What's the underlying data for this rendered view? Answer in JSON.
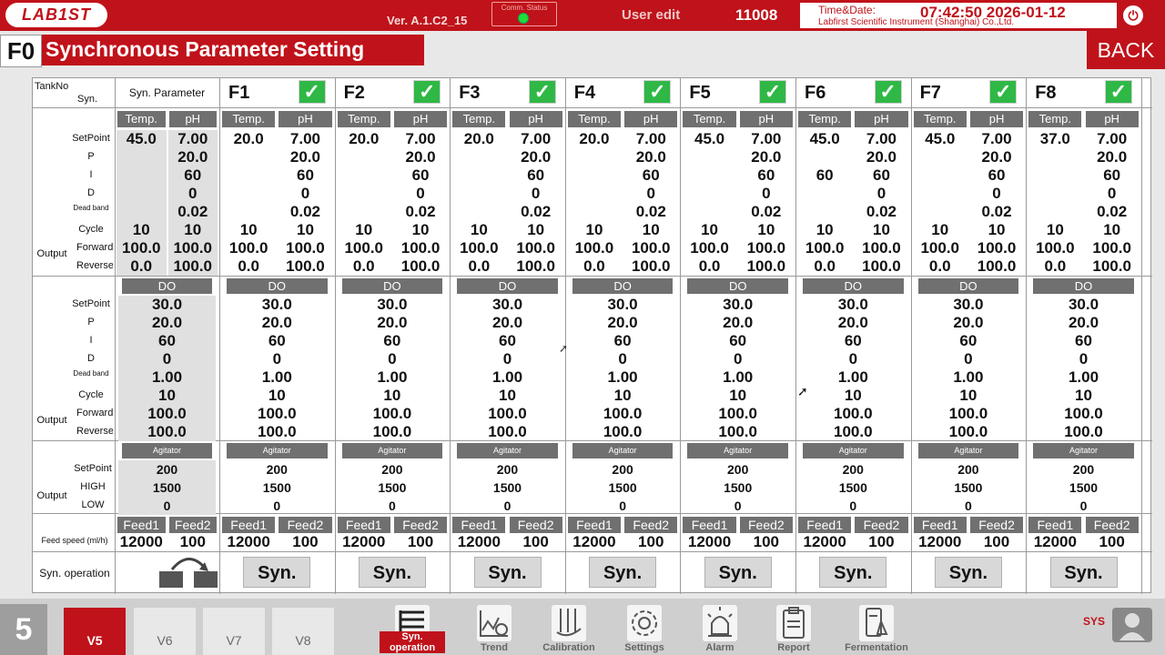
{
  "header": {
    "logo_text": "LAB1ST",
    "version": "Ver. A.1.C2_15",
    "comm_status_label": "Comm. Status",
    "user_label": "User edit",
    "user_code": "11008",
    "time_label": "Time&Date:",
    "company": "Labfirst Scientific Instrument (Shanghai) Co.,Ltd.",
    "datetime": "07:42:50 2026-01-12"
  },
  "title": {
    "code": "F0",
    "text": "Synchronous Parameter Setting",
    "back_label": "BACK"
  },
  "labels": {
    "tankno": "TankNo",
    "syn": "Syn.",
    "syn_parameter": "Syn. Parameter",
    "setpoint": "SetPoint",
    "p": "P",
    "i": "I",
    "d": "D",
    "deadband": "Dead band",
    "cycle": "Cycle",
    "output": "Output",
    "forward": "Forward",
    "reverse": "Reverse",
    "high": "HIGH",
    "low": "LOW",
    "feed_speed": "Feed speed (ml/h)",
    "syn_operation": "Syn. operation",
    "temp": "Temp.",
    "ph": "pH",
    "do": "DO",
    "agitator": "Agitator",
    "feed1": "Feed1",
    "feed2": "Feed2",
    "syn_button": "Syn.",
    "check_mark": "✓"
  },
  "columns": [
    {
      "name": "",
      "temp": {
        "setpoint": "45.0",
        "p": "",
        "i": "",
        "d": "",
        "deadband": "",
        "cycle": "10",
        "forward": "100.0",
        "reverse": "0.0"
      },
      "ph": {
        "setpoint": "7.00",
        "p": "20.0",
        "i": "60",
        "d": "0",
        "deadband": "0.02",
        "cycle": "10",
        "forward": "100.0",
        "reverse": "100.0"
      },
      "do": {
        "setpoint": "30.0",
        "p": "20.0",
        "i": "60",
        "d": "0",
        "deadband": "1.00",
        "cycle": "10",
        "forward": "100.0",
        "reverse": "100.0"
      },
      "agitator": {
        "setpoint": "200",
        "high": "1500",
        "low": "0"
      },
      "feed1": "12000",
      "feed2": "100"
    },
    {
      "name": "F1",
      "temp": {
        "setpoint": "20.0",
        "p": "",
        "i": "",
        "d": "",
        "deadband": "",
        "cycle": "10",
        "forward": "100.0",
        "reverse": "0.0"
      },
      "ph": {
        "setpoint": "7.00",
        "p": "20.0",
        "i": "60",
        "d": "0",
        "deadband": "0.02",
        "cycle": "10",
        "forward": "100.0",
        "reverse": "100.0"
      },
      "do": {
        "setpoint": "30.0",
        "p": "20.0",
        "i": "60",
        "d": "0",
        "deadband": "1.00",
        "cycle": "10",
        "forward": "100.0",
        "reverse": "100.0"
      },
      "agitator": {
        "setpoint": "200",
        "high": "1500",
        "low": "0"
      },
      "feed1": "12000",
      "feed2": "100"
    },
    {
      "name": "F2",
      "temp": {
        "setpoint": "20.0",
        "p": "",
        "i": "",
        "d": "",
        "deadband": "",
        "cycle": "10",
        "forward": "100.0",
        "reverse": "0.0"
      },
      "ph": {
        "setpoint": "7.00",
        "p": "20.0",
        "i": "60",
        "d": "0",
        "deadband": "0.02",
        "cycle": "10",
        "forward": "100.0",
        "reverse": "100.0"
      },
      "do": {
        "setpoint": "30.0",
        "p": "20.0",
        "i": "60",
        "d": "0",
        "deadband": "1.00",
        "cycle": "10",
        "forward": "100.0",
        "reverse": "100.0"
      },
      "agitator": {
        "setpoint": "200",
        "high": "1500",
        "low": "0"
      },
      "feed1": "12000",
      "feed2": "100"
    },
    {
      "name": "F3",
      "temp": {
        "setpoint": "20.0",
        "p": "",
        "i": "",
        "d": "",
        "deadband": "",
        "cycle": "10",
        "forward": "100.0",
        "reverse": "0.0"
      },
      "ph": {
        "setpoint": "7.00",
        "p": "20.0",
        "i": "60",
        "d": "0",
        "deadband": "0.02",
        "cycle": "10",
        "forward": "100.0",
        "reverse": "100.0"
      },
      "do": {
        "setpoint": "30.0",
        "p": "20.0",
        "i": "60",
        "d": "0",
        "deadband": "1.00",
        "cycle": "10",
        "forward": "100.0",
        "reverse": "100.0"
      },
      "agitator": {
        "setpoint": "200",
        "high": "1500",
        "low": "0"
      },
      "feed1": "12000",
      "feed2": "100"
    },
    {
      "name": "F4",
      "temp": {
        "setpoint": "20.0",
        "p": "",
        "i": "",
        "d": "",
        "deadband": "",
        "cycle": "10",
        "forward": "100.0",
        "reverse": "0.0"
      },
      "ph": {
        "setpoint": "7.00",
        "p": "20.0",
        "i": "60",
        "d": "0",
        "deadband": "0.02",
        "cycle": "10",
        "forward": "100.0",
        "reverse": "100.0"
      },
      "do": {
        "setpoint": "30.0",
        "p": "20.0",
        "i": "60",
        "d": "0",
        "deadband": "1.00",
        "cycle": "10",
        "forward": "100.0",
        "reverse": "100.0"
      },
      "agitator": {
        "setpoint": "200",
        "high": "1500",
        "low": "0"
      },
      "feed1": "12000",
      "feed2": "100"
    },
    {
      "name": "F5",
      "temp": {
        "setpoint": "45.0",
        "p": "",
        "i": "",
        "d": "",
        "deadband": "",
        "cycle": "10",
        "forward": "100.0",
        "reverse": "0.0"
      },
      "ph": {
        "setpoint": "7.00",
        "p": "20.0",
        "i": "60",
        "d": "0",
        "deadband": "0.02",
        "cycle": "10",
        "forward": "100.0",
        "reverse": "100.0"
      },
      "do": {
        "setpoint": "30.0",
        "p": "20.0",
        "i": "60",
        "d": "0",
        "deadband": "1.00",
        "cycle": "10",
        "forward": "100.0",
        "reverse": "100.0"
      },
      "agitator": {
        "setpoint": "200",
        "high": "1500",
        "low": "0"
      },
      "feed1": "12000",
      "feed2": "100"
    },
    {
      "name": "F6",
      "temp": {
        "setpoint": "45.0",
        "p": "",
        "i": "60",
        "d": "",
        "deadband": "",
        "cycle": "10",
        "forward": "100.0",
        "reverse": "0.0"
      },
      "ph": {
        "setpoint": "7.00",
        "p": "20.0",
        "i": "60",
        "d": "0",
        "deadband": "0.02",
        "cycle": "10",
        "forward": "100.0",
        "reverse": "100.0"
      },
      "do": {
        "setpoint": "30.0",
        "p": "20.0",
        "i": "60",
        "d": "0",
        "deadband": "1.00",
        "cycle": "10",
        "forward": "100.0",
        "reverse": "100.0"
      },
      "agitator": {
        "setpoint": "200",
        "high": "1500",
        "low": "0"
      },
      "feed1": "12000",
      "feed2": "100"
    },
    {
      "name": "F7",
      "temp": {
        "setpoint": "45.0",
        "p": "",
        "i": "",
        "d": "",
        "deadband": "",
        "cycle": "10",
        "forward": "100.0",
        "reverse": "0.0"
      },
      "ph": {
        "setpoint": "7.00",
        "p": "20.0",
        "i": "60",
        "d": "0",
        "deadband": "0.02",
        "cycle": "10",
        "forward": "100.0",
        "reverse": "100.0"
      },
      "do": {
        "setpoint": "30.0",
        "p": "20.0",
        "i": "60",
        "d": "0",
        "deadband": "1.00",
        "cycle": "10",
        "forward": "100.0",
        "reverse": "100.0"
      },
      "agitator": {
        "setpoint": "200",
        "high": "1500",
        "low": "0"
      },
      "feed1": "12000",
      "feed2": "100"
    },
    {
      "name": "F8",
      "temp": {
        "setpoint": "37.0",
        "p": "",
        "i": "",
        "d": "",
        "deadband": "",
        "cycle": "10",
        "forward": "100.0",
        "reverse": "0.0"
      },
      "ph": {
        "setpoint": "7.00",
        "p": "20.0",
        "i": "60",
        "d": "0",
        "deadband": "0.02",
        "cycle": "10",
        "forward": "100.0",
        "reverse": "100.0"
      },
      "do": {
        "setpoint": "30.0",
        "p": "20.0",
        "i": "60",
        "d": "0",
        "deadband": "1.00",
        "cycle": "10",
        "forward": "100.0",
        "reverse": "100.0"
      },
      "agitator": {
        "setpoint": "200",
        "high": "1500",
        "low": "0"
      },
      "feed1": "12000",
      "feed2": "100"
    }
  ],
  "footer": {
    "page_number": "5",
    "v_tabs": [
      "V5",
      "V6",
      "V7",
      "V8"
    ],
    "active_v_tab": "V5",
    "nav_items": [
      {
        "label": "Syn. operation",
        "icon": "list-icon"
      },
      {
        "label": "Trend",
        "icon": "trend-icon"
      },
      {
        "label": "Calibration",
        "icon": "calibration-icon"
      },
      {
        "label": "Settings",
        "icon": "gear-icon"
      },
      {
        "label": "Alarm",
        "icon": "alarm-icon"
      },
      {
        "label": "Report",
        "icon": "report-icon"
      },
      {
        "label": "Fermentation",
        "icon": "flask-icon"
      }
    ],
    "active_nav": "Syn. operation",
    "sys_label": "SYS"
  }
}
